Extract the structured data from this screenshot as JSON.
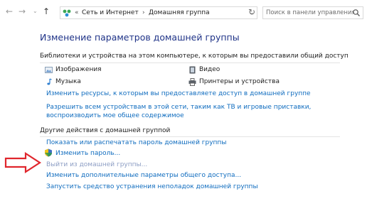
{
  "address_bar": {
    "breadcrumb": [
      "Сеть и Интернет",
      "Домашняя группа"
    ],
    "search_placeholder": "Поиск в панели управления"
  },
  "main": {
    "title": "Изменение параметров домашней группы",
    "shared_section": {
      "heading": "Библиотеки и устройства на этом компьютере, к которым вы предоставили общий доступ",
      "items": [
        "Изображения",
        "Видео",
        "Музыка",
        "Принтеры и устройства"
      ],
      "change_resources_link": "Изменить ресурсы, к которым вы предоставляете доступ в домашней группе",
      "allow_devices_link": "Разрешить всем устройствам в этой сети, таким как ТВ и игровые приставки, воспроизводить мое общее содержимое"
    },
    "other_section": {
      "heading": "Другие действия с домашней группой",
      "show_password_link": "Показать или распечатать пароль домашней группы",
      "change_password_link": "Изменить пароль...",
      "leave_link": "Выйти из домашней группы...",
      "advanced_link": "Изменить дополнительные параметры общего доступа...",
      "troubleshoot_link": "Запустить средство устранения неполадок домашней группы"
    }
  },
  "colors": {
    "link": "#0f6cbf",
    "title": "#1e3287",
    "arrow": "#e0262d"
  }
}
